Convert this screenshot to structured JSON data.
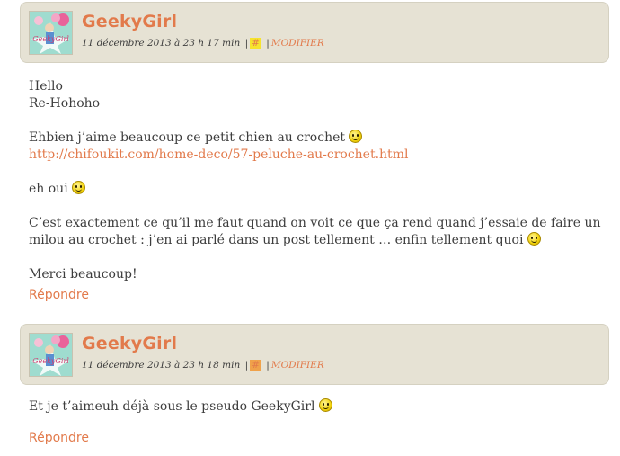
{
  "comments": [
    {
      "author": "GeekyGirl",
      "date": "11 décembre 2013 à 23 h 17 min",
      "separator": "|",
      "permalink": "#",
      "edit": "MODIFIER",
      "lines": {
        "p1a": "Hello",
        "p1b": "Re-Hohoho",
        "p2": "Ehbien j’aime beaucoup ce petit chien au crochet",
        "link": "http://chifoukit.com/home-deco/57-peluche-au-crochet.html",
        "p3": "eh oui",
        "p4": "C’est exactement ce qu’il me faut quand on voit ce que ça rend quand j’essaie de faire un milou au crochet : j’en ai parlé dans un post tellement … enfin tellement quoi",
        "p5": "Merci beaucoup!"
      },
      "reply": "Répondre"
    },
    {
      "author": "GeekyGirl",
      "date": "11 décembre 2013 à 23 h 18 min",
      "separator": "|",
      "permalink": "#",
      "edit": "MODIFIER",
      "lines": {
        "p1": "Et je t’aimeuh déjà sous le pseudo GeekyGirl"
      },
      "reply": "Répondre"
    }
  ],
  "avatar_text": "GeekyGirl",
  "icons": {
    "smiley": "smiley-icon"
  },
  "colors": {
    "accent": "#e27a4b",
    "header_bg": "#e6e2d4",
    "text": "#3d3d3d"
  }
}
